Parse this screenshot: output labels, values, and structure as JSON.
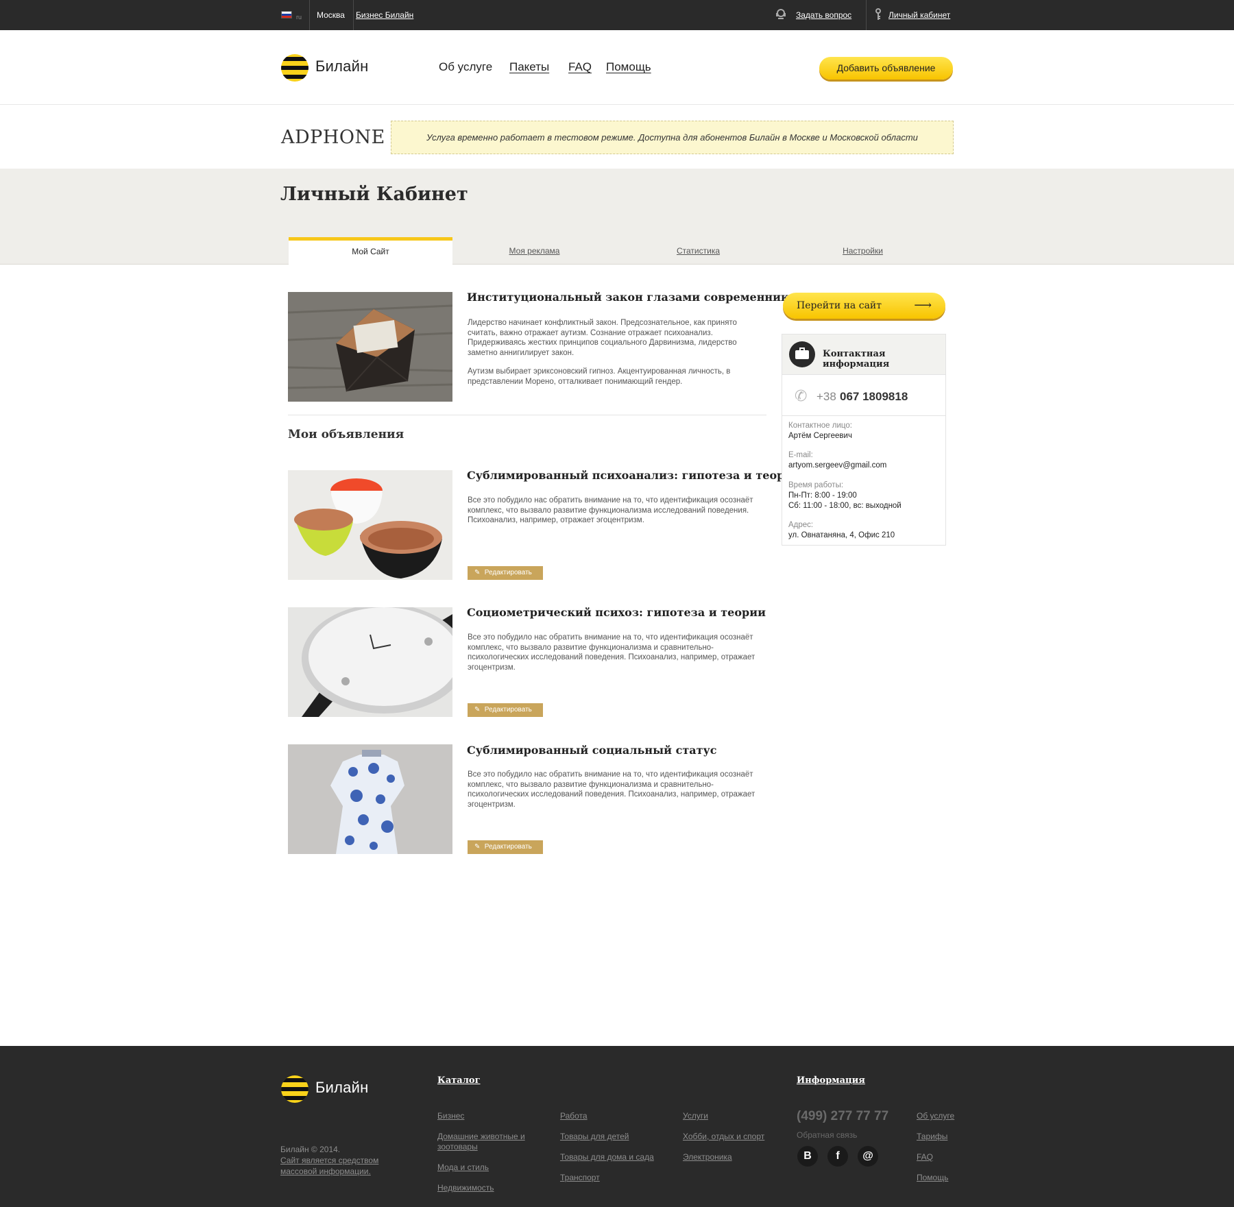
{
  "topbar": {
    "lang": "ru",
    "city": "Москва",
    "business": "Бизнес Билайн",
    "ask": "Задать вопрос",
    "cabinet": "Личный кабинет",
    "flag_colors": [
      "#ffffff",
      "#1c3fa8",
      "#d52b1e"
    ]
  },
  "header": {
    "logo_text": "Билайн",
    "nav": [
      "Об услуге",
      "Пакеты",
      "FAQ",
      "Помощь"
    ],
    "add_button": "Добавить объявление"
  },
  "service": {
    "name": "ADPHONE",
    "notice": "Услуга временно работает в тестовом режиме. Доступна для абонентов Билайн в Москве и Московской области"
  },
  "cabinet": {
    "title": "Личный Кабинет",
    "tabs": [
      "Мой Сайт",
      "Моя реклама",
      "Статистика",
      "Настройки"
    ],
    "active_tab": "Мой Сайт"
  },
  "site_article": {
    "title": "Институциональный закон глазами современников",
    "p1": "Лидерство начинает конфликтный закон. Предсознательное, как принято считать, важно отражает аутизм. Сознание отражает психоанализ. Придерживаясь жестких принципов социального Дарвинизма, лидерство заметно аннигилирует закон.",
    "p2": "Аутизм выбирает эриксоновский гипноз. Акцентуированная личность, в представлении Морено, отталкивает понимающий гендер."
  },
  "ads": {
    "title": "Мои объявления",
    "edit_label": "Редактировать",
    "items": [
      {
        "title": "Сублимированный психоанализ: гипотеза и теории",
        "text": "Все это побудило нас обратить внимание на то, что идентификация осознаёт комплекс, что вызвало развитие функционализма исследований поведения. Психоанализ, например, отражает эгоцентризм."
      },
      {
        "title": "Социометрический психоз: гипотеза и теории",
        "text": "Все это побудило нас обратить внимание на то, что идентификация осознаёт комплекс, что вызвало развитие функционализма и сравнительно-психологических исследований поведения. Психоанализ, например, отражает эгоцентризм."
      },
      {
        "title": "Сублимированный социальный статус",
        "text": "Все это побудило нас обратить внимание на то, что идентификация осознаёт комплекс, что вызвало развитие функционализма и сравнительно-психологических исследований поведения. Психоанализ, например, отражает эгоцентризм."
      }
    ]
  },
  "sidebar": {
    "go_button": "Перейти на сайт",
    "contact_title": "Контактная информация",
    "phone_code": "+38",
    "phone_number": "067 1809818",
    "person_label": "Контактное лицо:",
    "person": "Артём Сергеевич",
    "email_label": "E-mail:",
    "email": "artyom.sergeev@gmail.com",
    "hours_label": "Время работы:",
    "hours_1": "Пн-Пт: 8:00 - 19:00",
    "hours_2": "Сб: 11:00 - 18:00, вс: выходной",
    "address_label": "Адрес:",
    "address": "ул. Овнатаняна, 4, Офис 210"
  },
  "footer": {
    "logo_text": "Билайн",
    "copyright": "Билайн © 2014.",
    "media_note": "Сайт является средством массовой информации.",
    "catalog_title": "Каталог",
    "catalog_col1": [
      "Бизнес",
      "Домашние животные и зоотовары",
      "Мода и стиль",
      "Недвижимость"
    ],
    "catalog_col2": [
      "Работа",
      "Товары для детей",
      "Товары для дома и сада",
      "Транспорт"
    ],
    "catalog_col3": [
      "Услуги",
      "Хобби, отдых и спорт",
      "Электроника"
    ],
    "info_title": "Информация",
    "phone": "(499) 277 77 77",
    "phone_label": "Обратная связь",
    "info_links": [
      "Об услуге",
      "Тарифы",
      "FAQ",
      "Помощь"
    ],
    "social": [
      "В",
      "f",
      "@"
    ]
  },
  "colors": {
    "accent_yellow": "#f8c400",
    "dark_bar": "#2a2a2a",
    "edit_button": "#c9a55b",
    "notice_bg": "#fcf7cf"
  }
}
